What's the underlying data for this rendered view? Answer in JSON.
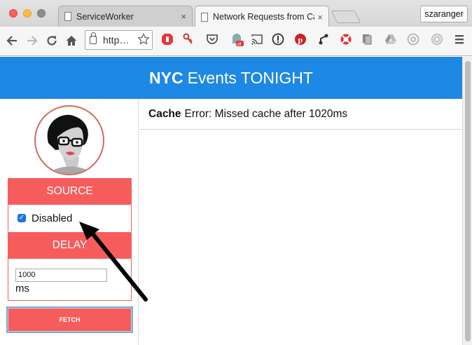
{
  "browser": {
    "tabs": [
      {
        "label": "ServiceWorker",
        "close": "×"
      },
      {
        "label": "Network Requests from Ca",
        "close": "×"
      }
    ],
    "profile_name": "szaranger",
    "address_text": "http…",
    "nav_icons": [
      "back-icon",
      "forward-icon",
      "reload-icon",
      "home-icon"
    ],
    "bookmark_icon": "star-icon",
    "menu_icon": "hamburger-menu-icon"
  },
  "app": {
    "title_bold": "NYC",
    "title_rest": "Events TONIGHT",
    "header_color": "#1e88e5",
    "accent_color": "#f65c5c"
  },
  "sidebar": {
    "source_heading": "SOURCE",
    "source_option_label": "Disabled",
    "source_checked": true,
    "delay_heading": "DELAY",
    "delay_value": "1000",
    "delay_unit": "ms",
    "fetch_label": "FETCH"
  },
  "log": {
    "entries": [
      {
        "source": "Cache",
        "message": "Error: Missed cache after 1020ms"
      }
    ]
  }
}
